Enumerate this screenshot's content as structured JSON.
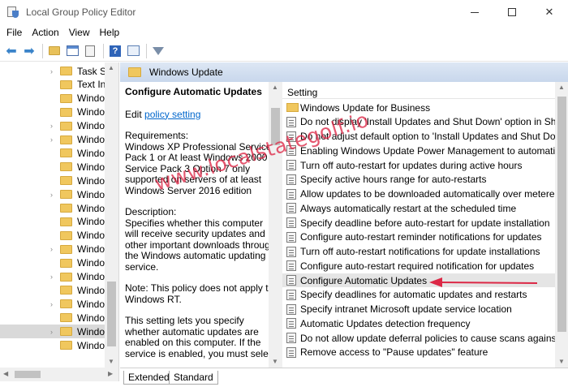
{
  "window": {
    "title": "Local Group Policy Editor",
    "minimize_glyph": "—",
    "maximize_glyph": "☐",
    "close_glyph": "✕"
  },
  "menu": [
    "File",
    "Action",
    "View",
    "Help"
  ],
  "toolbar": {
    "icons": [
      "back-arrow-icon",
      "forward-arrow-icon",
      "up-folder-icon",
      "show-hide-tree-icon",
      "export-list-icon",
      "help-icon",
      "view-icon",
      "filter-icon"
    ],
    "back_glyph": "⬅",
    "forward_glyph": "➡",
    "help_glyph": "?"
  },
  "tree": {
    "items": [
      {
        "label": "Task Sc",
        "expandable": true
      },
      {
        "label": "Text Inp",
        "expandable": false
      },
      {
        "label": "Windo",
        "expandable": false
      },
      {
        "label": "Windo",
        "expandable": false
      },
      {
        "label": "Windo",
        "expandable": true
      },
      {
        "label": "Windo",
        "expandable": true
      },
      {
        "label": "Windo",
        "expandable": false
      },
      {
        "label": "Windo",
        "expandable": false
      },
      {
        "label": "Windo",
        "expandable": false
      },
      {
        "label": "Windo",
        "expandable": true
      },
      {
        "label": "Windo",
        "expandable": false
      },
      {
        "label": "Windo",
        "expandable": false
      },
      {
        "label": "Windo",
        "expandable": false
      },
      {
        "label": "Windo",
        "expandable": true
      },
      {
        "label": "Windo",
        "expandable": false
      },
      {
        "label": "Windo",
        "expandable": true
      },
      {
        "label": "Windo",
        "expandable": false
      },
      {
        "label": "Windo",
        "expandable": true
      },
      {
        "label": "Windo",
        "expandable": false
      },
      {
        "label": "Windo",
        "expandable": true,
        "selected": true
      },
      {
        "label": "Windo",
        "expandable": false
      }
    ]
  },
  "header": {
    "title": "Windows Update"
  },
  "description": {
    "policy_title": "Configure Automatic Updates",
    "edit_prefix": "Edit ",
    "edit_link": "policy setting ",
    "requirements": "Requirements:\nWindows XP Professional Service Pack 1 or At least Windows 2000 Service Pack 3 Option 7 only supported on servers of at least Windows Server 2016 edition",
    "description": "Description:\nSpecifies whether this computer will receive security updates and other important downloads through the Windows automatic updating service.",
    "note": "Note: This policy does not apply to Windows RT.",
    "more": "This setting lets you specify whether automatic updates are enabled on this computer. If the service is enabled, you must select"
  },
  "settings": {
    "column_header": "Setting",
    "rows": [
      {
        "label": "Windows Update for Business",
        "type": "folder"
      },
      {
        "label": "Do not display 'Install Updates and Shut Down' option in Sh",
        "type": "policy"
      },
      {
        "label": "Do not adjust default option to 'Install Updates and Shut Do",
        "type": "policy"
      },
      {
        "label": "Enabling Windows Update Power Management to automatic",
        "type": "policy"
      },
      {
        "label": "Turn off auto-restart for updates during active hours",
        "type": "policy"
      },
      {
        "label": "Specify active hours range for auto-restarts",
        "type": "policy"
      },
      {
        "label": "Allow updates to be downloaded automatically over metered",
        "type": "policy"
      },
      {
        "label": "Always automatically restart at the scheduled time",
        "type": "policy"
      },
      {
        "label": "Specify deadline before auto-restart for update installation",
        "type": "policy"
      },
      {
        "label": "Configure auto-restart reminder notifications for updates",
        "type": "policy"
      },
      {
        "label": "Turn off auto-restart notifications for update installations",
        "type": "policy"
      },
      {
        "label": "Configure auto-restart required notification for updates",
        "type": "policy"
      },
      {
        "label": "Configure Automatic Updates",
        "type": "policy",
        "selected": true
      },
      {
        "label": "Specify deadlines for automatic updates and restarts",
        "type": "policy"
      },
      {
        "label": "Specify intranet Microsoft update service location",
        "type": "policy"
      },
      {
        "label": "Automatic Updates detection frequency",
        "type": "policy"
      },
      {
        "label": "Do not allow update deferral policies to cause scans against",
        "type": "policy"
      },
      {
        "label": "Remove access to \"Pause updates\" feature",
        "type": "policy"
      }
    ]
  },
  "tabs": [
    "Extended",
    "Standard"
  ],
  "watermark": "www.localstategolf.io",
  "colors": {
    "accent": "#0066cc",
    "header_bg": "#c8d7ec",
    "selection": "#e5e5e5",
    "annotation": "#dc2846"
  }
}
